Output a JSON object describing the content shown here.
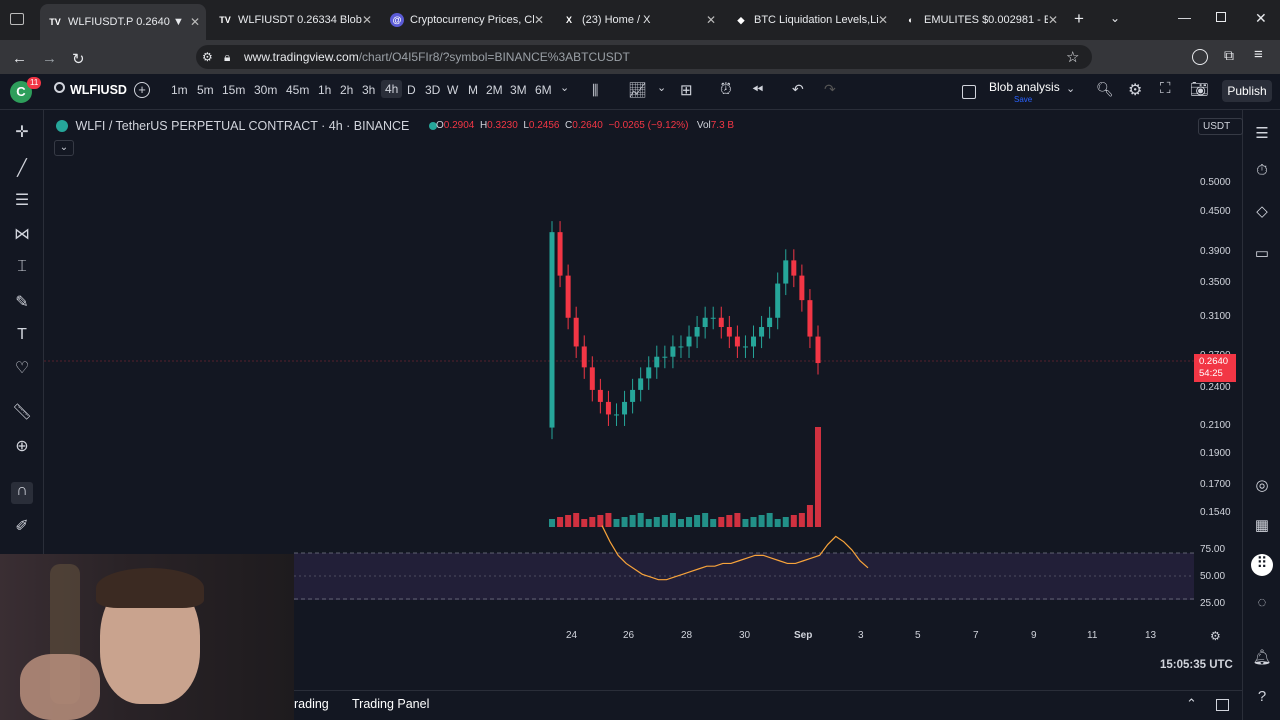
{
  "browser": {
    "tabs": [
      {
        "title": "WLFIUSDT.P 0.2640 ▼ −15",
        "favicon": "TV"
      },
      {
        "title": "WLFIUSDT 0.26334 Blob ana",
        "favicon": "TV"
      },
      {
        "title": "Cryptocurrency Prices, Chart",
        "favicon": "@"
      },
      {
        "title": "(23) Home / X",
        "favicon": "X"
      },
      {
        "title": "BTC Liquidation Levels,Liquid",
        "favicon": "◆"
      },
      {
        "title": "EMULITES $0.002981 - Emul",
        "favicon": "◐"
      }
    ],
    "url_host": "www.tradingview.com",
    "url_path": "/chart/O4I5FIr8/?symbol=BINANCE%3ABTCUSDT"
  },
  "toolbar": {
    "avatar_letter": "C",
    "notif_count": "11",
    "symbol": "WLFIUSD",
    "timeframes": [
      "1m",
      "5m",
      "15m",
      "30m",
      "45m",
      "1h",
      "2h",
      "3h",
      "4h",
      "D",
      "3D",
      "W",
      "M",
      "2M",
      "3M",
      "6M"
    ],
    "selected_tf": "4h",
    "indicator_name": "Blob analysis",
    "indicator_sub": "Save",
    "publish": "Publish"
  },
  "legend": {
    "title": "WLFI / TetherUS PERPETUAL CONTRACT · 4h · BINANCE",
    "o_label": "O",
    "o": "0.2904",
    "h_label": "H",
    "h": "0.3230",
    "l_label": "L",
    "l": "0.2456",
    "c_label": "C",
    "c": "0.2640",
    "change": "−0.0265 (−9.12%)",
    "vol_label": "Vol",
    "vol": "7.3 B"
  },
  "price_scale": {
    "currency": "USDT",
    "labels": [
      "0.5000",
      "0.4500",
      "0.3900",
      "0.3500",
      "0.3100",
      "0.2700",
      "0.2400",
      "0.2100",
      "0.1900",
      "0.1700",
      "0.1540"
    ],
    "current_price": "0.2640",
    "countdown": "54:25"
  },
  "oscillator_scale": [
    "75.00",
    "50.00",
    "25.00"
  ],
  "time_axis": [
    "24",
    "26",
    "28",
    "30",
    "Sep",
    "3",
    "5",
    "7",
    "9",
    "11",
    "13"
  ],
  "clock": "15:05:35 UTC",
  "bottom": {
    "tab1": "rading",
    "tab2": "Trading Panel"
  },
  "colors": {
    "up": "#26a69a",
    "down": "#f23645",
    "bg": "#131722",
    "osc": "#f7a33b"
  },
  "chart_data": {
    "type": "candlestick",
    "y_scale": "log",
    "candles_close": [
      0.42,
      0.36,
      0.31,
      0.28,
      0.26,
      0.24,
      0.23,
      0.22,
      0.22,
      0.23,
      0.24,
      0.25,
      0.26,
      0.27,
      0.27,
      0.28,
      0.28,
      0.29,
      0.3,
      0.31,
      0.31,
      0.3,
      0.29,
      0.28,
      0.28,
      0.29,
      0.3,
      0.31,
      0.35,
      0.38,
      0.36,
      0.33,
      0.29,
      0.264
    ]
  }
}
